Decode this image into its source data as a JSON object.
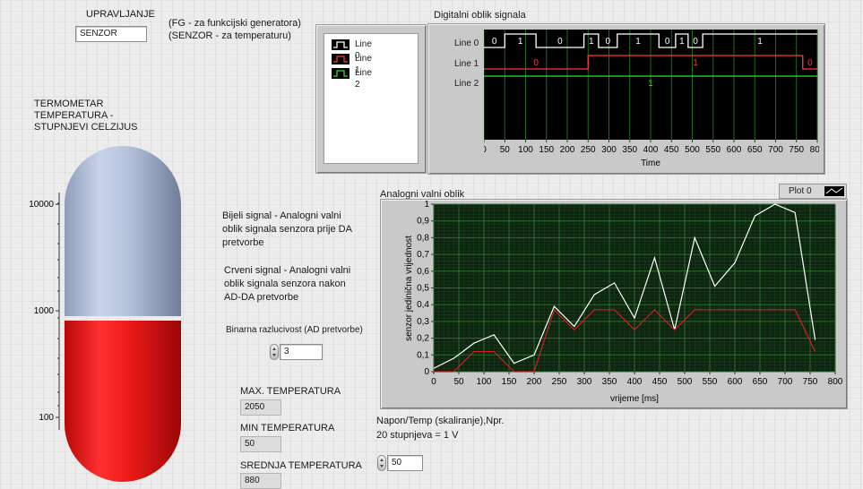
{
  "control": {
    "label": "UPRAVLJANJE",
    "value": "SENZOR",
    "hint_line1": "(FG - za funkcijski generatora)",
    "hint_line2": "(SENZOR - za temperaturu)"
  },
  "thermometer": {
    "title_line1": "TERMOMETAR",
    "title_line2": "TEMPERATURA -",
    "title_line3": "STUPNJEVI CELZIJUS",
    "ticks": [
      "10000",
      "1000",
      "100"
    ],
    "fill_level": 0.48,
    "colors": {
      "fill": "#e81414",
      "empty": "#a8b7d6"
    }
  },
  "descriptions": {
    "white_line1": "Bijeli signal - Analogni valni",
    "white_line2": "oblik signala senzora prije DA",
    "white_line3": "pretvorbe",
    "red_line1": "Crveni signal - Analogni valni",
    "red_line2": "oblik signala senzora  nakon",
    "red_line3": "AD-DA pretvorbe"
  },
  "resolution": {
    "label": "Binarna razlucivost (AD pretvorbe)",
    "value": "3"
  },
  "stats": {
    "max_label": "MAX. TEMPERATURA",
    "max_value": "2050",
    "min_label": "MIN TEMPERATURA",
    "min_value": "50",
    "avg_label": "SREDNJA TEMPERATURA",
    "avg_value": "880"
  },
  "scaling": {
    "label_line1": "Napon/Temp (skaliranje),Npr.",
    "label_line2": " 20 stupnjeva = 1 V",
    "value": "50"
  },
  "digital": {
    "title": "Digitalni oblik signala",
    "legend": [
      "Line 0",
      "Line 1",
      "Line 2"
    ],
    "line_names": [
      "Line 0",
      "Line 1",
      "Line 2"
    ],
    "colors": [
      "#ffffff",
      "#ff3b3b",
      "#33dd33"
    ],
    "x_ticks": [
      0,
      50,
      100,
      150,
      200,
      250,
      300,
      350,
      400,
      450,
      500,
      550,
      600,
      650,
      700,
      750,
      800
    ],
    "xlabel": "Time",
    "line0_transitions": [
      0,
      1,
      0,
      1,
      0,
      1,
      0,
      1,
      0,
      1
    ],
    "line0_segments": [
      [
        0,
        50,
        0
      ],
      [
        50,
        125,
        1
      ],
      [
        125,
        240,
        0
      ],
      [
        240,
        275,
        1
      ],
      [
        275,
        320,
        0
      ],
      [
        320,
        420,
        1
      ],
      [
        420,
        460,
        0
      ],
      [
        460,
        490,
        1
      ],
      [
        490,
        525,
        0
      ],
      [
        525,
        800,
        1
      ]
    ],
    "line0_label_text": [
      "0",
      "1",
      "0",
      "1",
      "0",
      "1",
      "0",
      "1",
      "0",
      "1"
    ],
    "line1_segments": [
      [
        0,
        250,
        0
      ],
      [
        250,
        765,
        1
      ],
      [
        765,
        800,
        0
      ]
    ],
    "line1_label_text": [
      "0",
      "1",
      "0"
    ],
    "line2_label_text": [
      "1"
    ]
  },
  "analog": {
    "title": "Analogni valni oblik",
    "plot_legend": "Plot 0",
    "colors": {
      "white": "#ffffff",
      "red": "#cc2020",
      "grid": "#2f6b2f",
      "bg": "#0d2410"
    }
  },
  "chart_data": {
    "type": "line",
    "title": "Analogni valni oblik",
    "xlabel": "vrijeme [ms]",
    "ylabel": "senzor  jedinična vrijednost",
    "xlim": [
      0,
      800
    ],
    "ylim": [
      0,
      1
    ],
    "x_ticks": [
      0,
      50,
      100,
      150,
      200,
      250,
      300,
      350,
      400,
      450,
      500,
      550,
      600,
      650,
      700,
      750,
      800
    ],
    "y_ticks": [
      "0",
      "0,1",
      "0,2",
      "0,3",
      "0,4",
      "0,5",
      "0,6",
      "0,7",
      "0,8",
      "0,9",
      "1"
    ],
    "series": [
      {
        "name": "Plot 0",
        "color": "#ffffff",
        "x": [
          0,
          40,
          80,
          120,
          160,
          200,
          240,
          280,
          320,
          360,
          400,
          440,
          480,
          520,
          560,
          600,
          640,
          680,
          720,
          760
        ],
        "y": [
          0.02,
          0.08,
          0.17,
          0.22,
          0.05,
          0.1,
          0.39,
          0.27,
          0.46,
          0.53,
          0.32,
          0.68,
          0.25,
          0.8,
          0.51,
          0.65,
          0.93,
          1.0,
          0.95,
          0.19
        ]
      },
      {
        "color": "#cc2020",
        "x": [
          0,
          40,
          80,
          120,
          160,
          200,
          240,
          280,
          320,
          360,
          400,
          440,
          480,
          520,
          560,
          600,
          640,
          680,
          720,
          760
        ],
        "y": [
          0,
          0,
          0.12,
          0.12,
          0,
          0,
          0.37,
          0.25,
          0.37,
          0.37,
          0.25,
          0.37,
          0.25,
          0.37,
          0.37,
          0.37,
          0.37,
          0.37,
          0.37,
          0.12
        ]
      }
    ]
  }
}
